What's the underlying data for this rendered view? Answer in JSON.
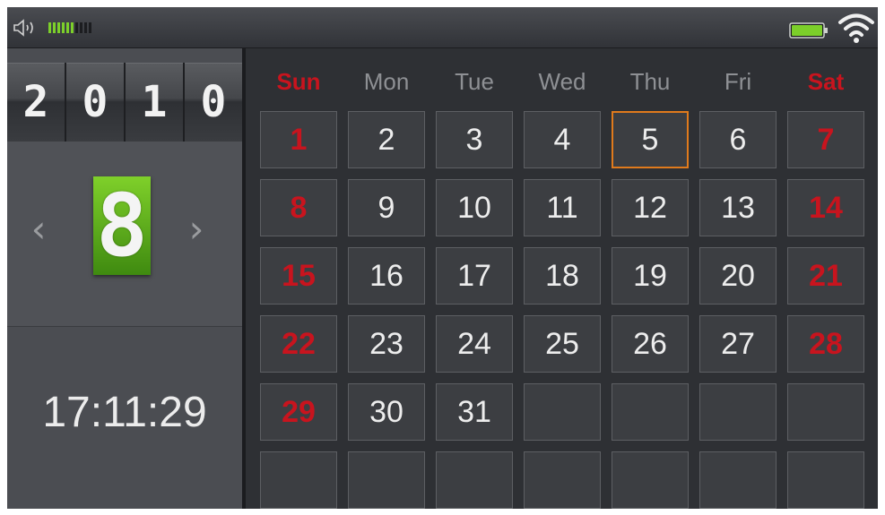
{
  "status": {
    "volume_level": 6,
    "volume_max": 10,
    "battery_level": 1.0,
    "icons": [
      "speaker-icon",
      "battery-icon",
      "wifi-icon"
    ],
    "colors": {
      "active": "#7ccf2a",
      "inactive": "#1c1d20"
    }
  },
  "left": {
    "year_digits": [
      "2",
      "0",
      "1",
      "0"
    ],
    "month": "8",
    "prev_label": "‹",
    "next_label": "›",
    "time": "17:11:29"
  },
  "calendar": {
    "day_headers": [
      "Sun",
      "Mon",
      "Tue",
      "Wed",
      "Thu",
      "Fri",
      "Sat"
    ],
    "weeks": [
      [
        "1",
        "2",
        "3",
        "4",
        "5",
        "6",
        "7"
      ],
      [
        "8",
        "9",
        "10",
        "11",
        "12",
        "13",
        "14"
      ],
      [
        "15",
        "16",
        "17",
        "18",
        "19",
        "20",
        "21"
      ],
      [
        "22",
        "23",
        "24",
        "25",
        "26",
        "27",
        "28"
      ],
      [
        "29",
        "30",
        "31",
        "",
        "",
        "",
        ""
      ],
      [
        "",
        "",
        "",
        "",
        "",
        "",
        ""
      ]
    ],
    "selected_day": "5",
    "colors": {
      "weekend": "#c8141e",
      "selected_border": "#e07a1c"
    }
  }
}
